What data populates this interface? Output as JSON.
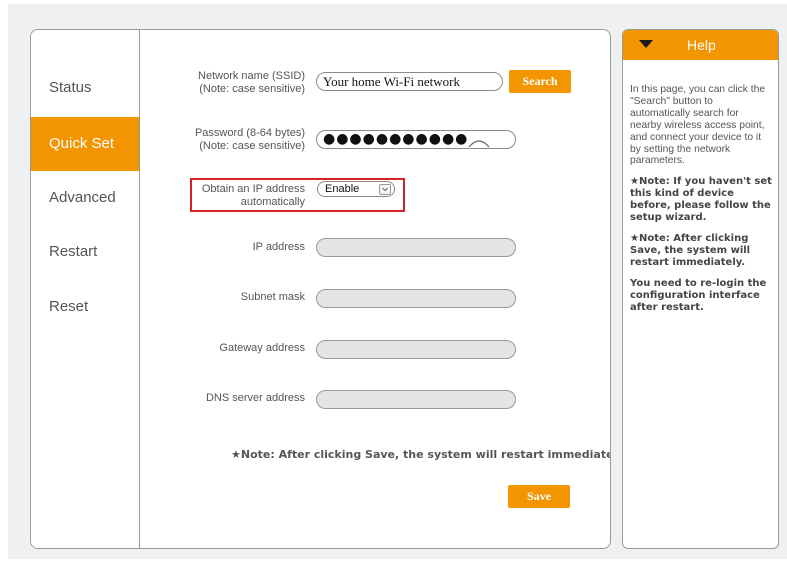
{
  "sidebar": {
    "items": [
      {
        "label": "Status",
        "active": false
      },
      {
        "label": "Quick Set",
        "active": true
      },
      {
        "label": "Advanced",
        "active": false
      },
      {
        "label": "Restart",
        "active": false
      },
      {
        "label": "Reset",
        "active": false
      }
    ]
  },
  "form": {
    "ssid": {
      "label_line1": "Network name (SSID)",
      "label_line2": "(Note: case sensitive)",
      "value": "Your home Wi-Fi network"
    },
    "search_button": "Search",
    "password": {
      "label_line1": "Password (8-64 bytes)",
      "label_line2": "(Note: case sensitive)",
      "masked_value": "●●●●●●●●●●●"
    },
    "obtain_ip": {
      "label_line1": "Obtain an IP address",
      "label_line2": "automatically",
      "selected": "Enable"
    },
    "ip_address": {
      "label": "IP address",
      "value": ""
    },
    "subnet_mask": {
      "label": "Subnet mask",
      "value": ""
    },
    "gateway": {
      "label": "Gateway address",
      "value": ""
    },
    "dns": {
      "label": "DNS server address",
      "value": ""
    },
    "note": "★Note: After clicking Save, the system will restart immediately.",
    "save_button": "Save"
  },
  "help": {
    "title": "Help",
    "paragraph1": "In this page, you can click the \"Search\" button to automatically search for nearby wireless access point, and connect your device to it by setting the network parameters.",
    "note1": "★Note: If you haven't set this kind of device before, please follow the setup wizard.",
    "note2": "★Note: After clicking Save, the system will restart immediately.",
    "note3": "You need to re-login the configuration interface after restart."
  },
  "colors": {
    "accent": "#f29500",
    "highlight": "#d62027"
  },
  "icons": {
    "help_toggle": "triangle-down-icon",
    "password_toggle": "eye-icon",
    "select_arrow": "chevron-down-icon"
  }
}
